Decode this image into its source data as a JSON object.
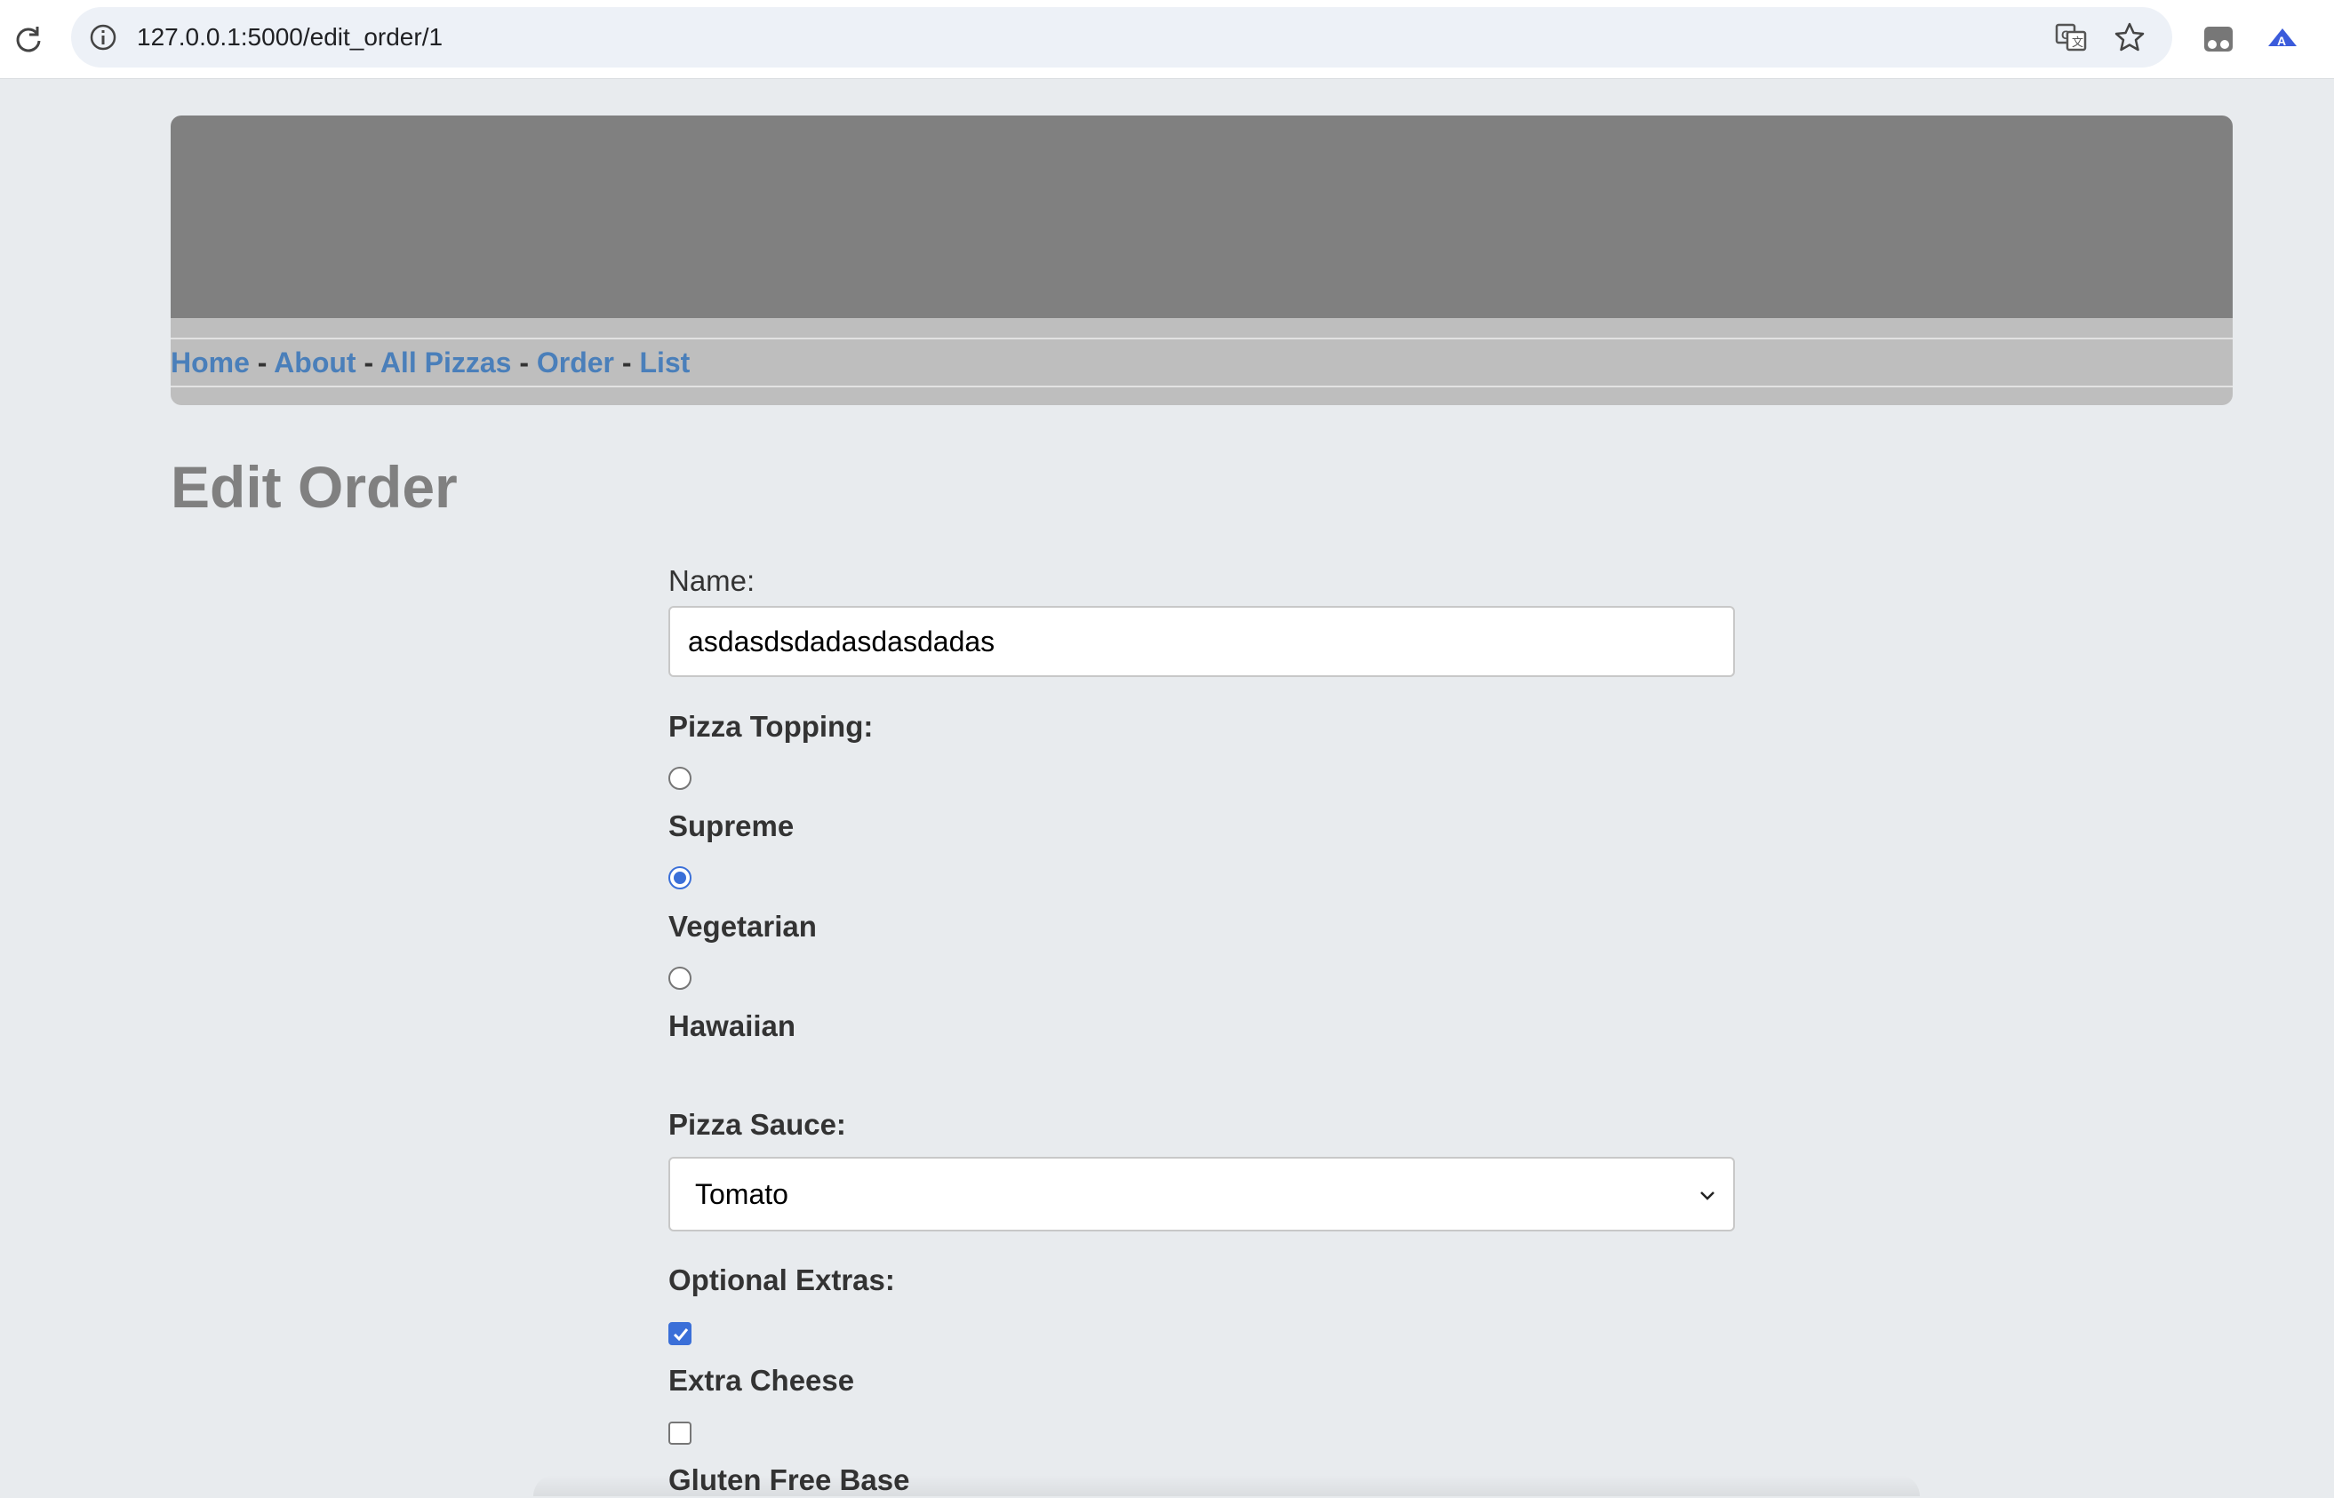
{
  "browser": {
    "url": "127.0.0.1:5000/edit_order/1",
    "icons": [
      "reload-icon",
      "site-info-icon",
      "translate-icon",
      "bookmark-star-icon",
      "incognito-icon",
      "extension-icon"
    ]
  },
  "nav": {
    "links": [
      "Home",
      "About",
      "All Pizzas",
      "Order",
      "List"
    ],
    "separator": "-"
  },
  "page": {
    "title": "Edit Order"
  },
  "form": {
    "name_label": "Name:",
    "name_value": "asdasdsdadasdasdadas",
    "topping_label": "Pizza Topping:",
    "toppings": [
      {
        "label": "Supreme",
        "selected": false
      },
      {
        "label": "Vegetarian",
        "selected": true
      },
      {
        "label": "Hawaiian",
        "selected": false
      }
    ],
    "sauce_label": "Pizza Sauce:",
    "sauce_value": "Tomato",
    "extras_label": "Optional Extras:",
    "extras": [
      {
        "label": "Extra Cheese",
        "checked": true
      },
      {
        "label": "Gluten Free Base",
        "checked": false
      }
    ]
  },
  "colors": {
    "accent": "#3a6fd8",
    "link": "#4a7fba",
    "banner": "#808080",
    "navbar": "#bebebe",
    "page_bg": "#e8ebee"
  }
}
